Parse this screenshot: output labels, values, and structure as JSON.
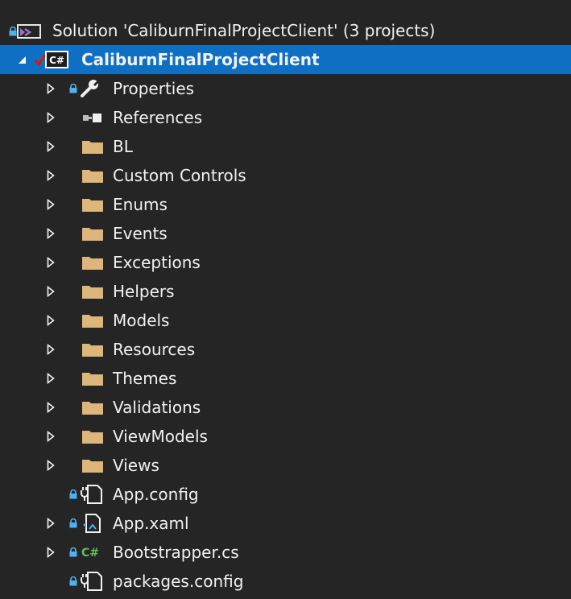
{
  "solution": {
    "label": "Solution 'CaliburnFinalProjectClient' (3 projects)",
    "icon": "visual-studio-solution-icon"
  },
  "project": {
    "label": "CaliburnFinalProjectClient",
    "icon": "csharp-project-icon",
    "lang": "C#",
    "expanded": true,
    "selected": true
  },
  "items": [
    {
      "label": "Properties",
      "icon": "wrench-icon",
      "expander": true
    },
    {
      "label": "References",
      "icon": "references-icon",
      "expander": true
    },
    {
      "label": "BL",
      "icon": "folder-icon",
      "expander": true
    },
    {
      "label": "Custom Controls",
      "icon": "folder-icon",
      "expander": true
    },
    {
      "label": "Enums",
      "icon": "folder-icon",
      "expander": true
    },
    {
      "label": "Events",
      "icon": "folder-icon",
      "expander": true
    },
    {
      "label": "Exceptions",
      "icon": "folder-icon",
      "expander": true
    },
    {
      "label": "Helpers",
      "icon": "folder-icon",
      "expander": true
    },
    {
      "label": "Models",
      "icon": "folder-icon",
      "expander": true
    },
    {
      "label": "Resources",
      "icon": "folder-icon",
      "expander": true
    },
    {
      "label": "Themes",
      "icon": "folder-icon",
      "expander": true
    },
    {
      "label": "Validations",
      "icon": "folder-icon",
      "expander": true
    },
    {
      "label": "ViewModels",
      "icon": "folder-icon",
      "expander": true
    },
    {
      "label": "Views",
      "icon": "folder-icon",
      "expander": true
    },
    {
      "label": "App.config",
      "icon": "config-file-icon",
      "expander": false
    },
    {
      "label": "App.xaml",
      "icon": "xaml-file-icon",
      "expander": true
    },
    {
      "label": "Bootstrapper.cs",
      "icon": "csharp-file-icon",
      "expander": true,
      "lang": "C#"
    },
    {
      "label": "packages.config",
      "icon": "config-file-icon",
      "expander": false
    }
  ],
  "colors": {
    "background": "#252526",
    "selection": "#0e6fc3",
    "text": "#f1f1f1",
    "folder": "#dcb67a",
    "lock": "#4fb2f0",
    "check": "#e51400",
    "csharp": "#5fbf55"
  }
}
